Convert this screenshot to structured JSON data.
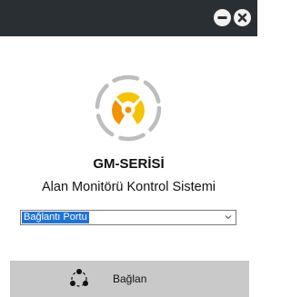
{
  "window": {
    "titlebar_color": "#2a2f33",
    "buttons": {
      "minimize_icon": "minus-circle-icon",
      "close_icon": "x-circle-icon"
    }
  },
  "logo": {
    "icon": "radiation-trefoil-logo",
    "colors": {
      "yellow": "#f5c400",
      "orange": "#f29200",
      "gray": "#bdbdbd"
    }
  },
  "header": {
    "product": "GM-SERİSİ",
    "subtitle": "Alan Monitörü Kontrol Sistemi"
  },
  "port_select": {
    "selected": "Bağlantı Portu",
    "highlight_color": "#1e73d8"
  },
  "connect": {
    "label": "Bağlan",
    "icon": "connection-nodes-icon",
    "bar_color": "#c9c9c9"
  }
}
